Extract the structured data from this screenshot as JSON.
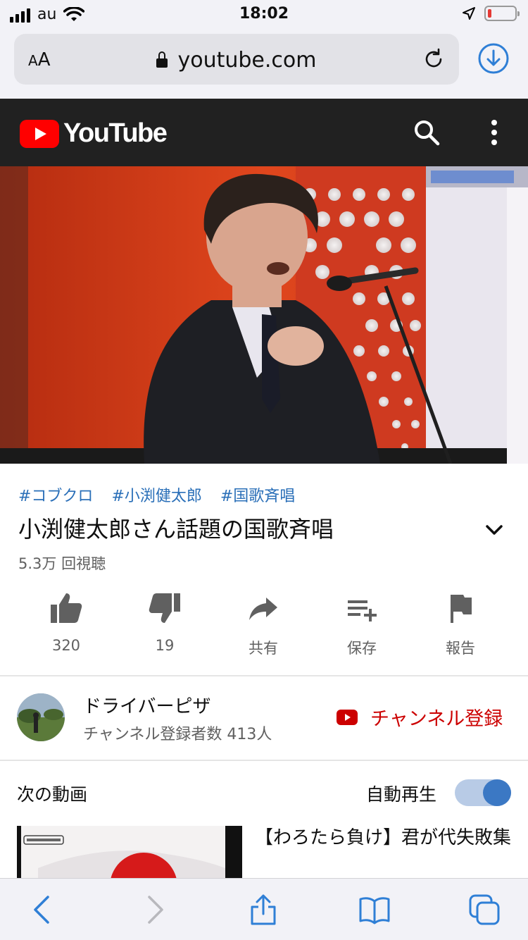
{
  "status_bar": {
    "carrier": "au",
    "time": "18:02"
  },
  "safari": {
    "text_size_label": "AA",
    "url": "youtube.com"
  },
  "youtube": {
    "logo_text": "YouTube",
    "brand_color": "#ff0000"
  },
  "video": {
    "hashtags": [
      "#コブクロ",
      "#小渕健太郎",
      "#国歌斉唱"
    ],
    "title": "小渕健太郎さん話題の国歌斉唱",
    "views": "5.3万 回視聴",
    "actions": {
      "like": "320",
      "dislike": "19",
      "share": "共有",
      "save": "保存",
      "report": "報告"
    }
  },
  "channel": {
    "name": "ドライバーピザ",
    "subscribers": "チャンネル登録者数 413人",
    "subscribe_label": "チャンネル登録"
  },
  "up_next": {
    "heading": "次の動画",
    "autoplay_label": "自動再生",
    "autoplay_on": true,
    "items": [
      {
        "title": "【わろたら負け】君が代失敗集"
      }
    ]
  }
}
